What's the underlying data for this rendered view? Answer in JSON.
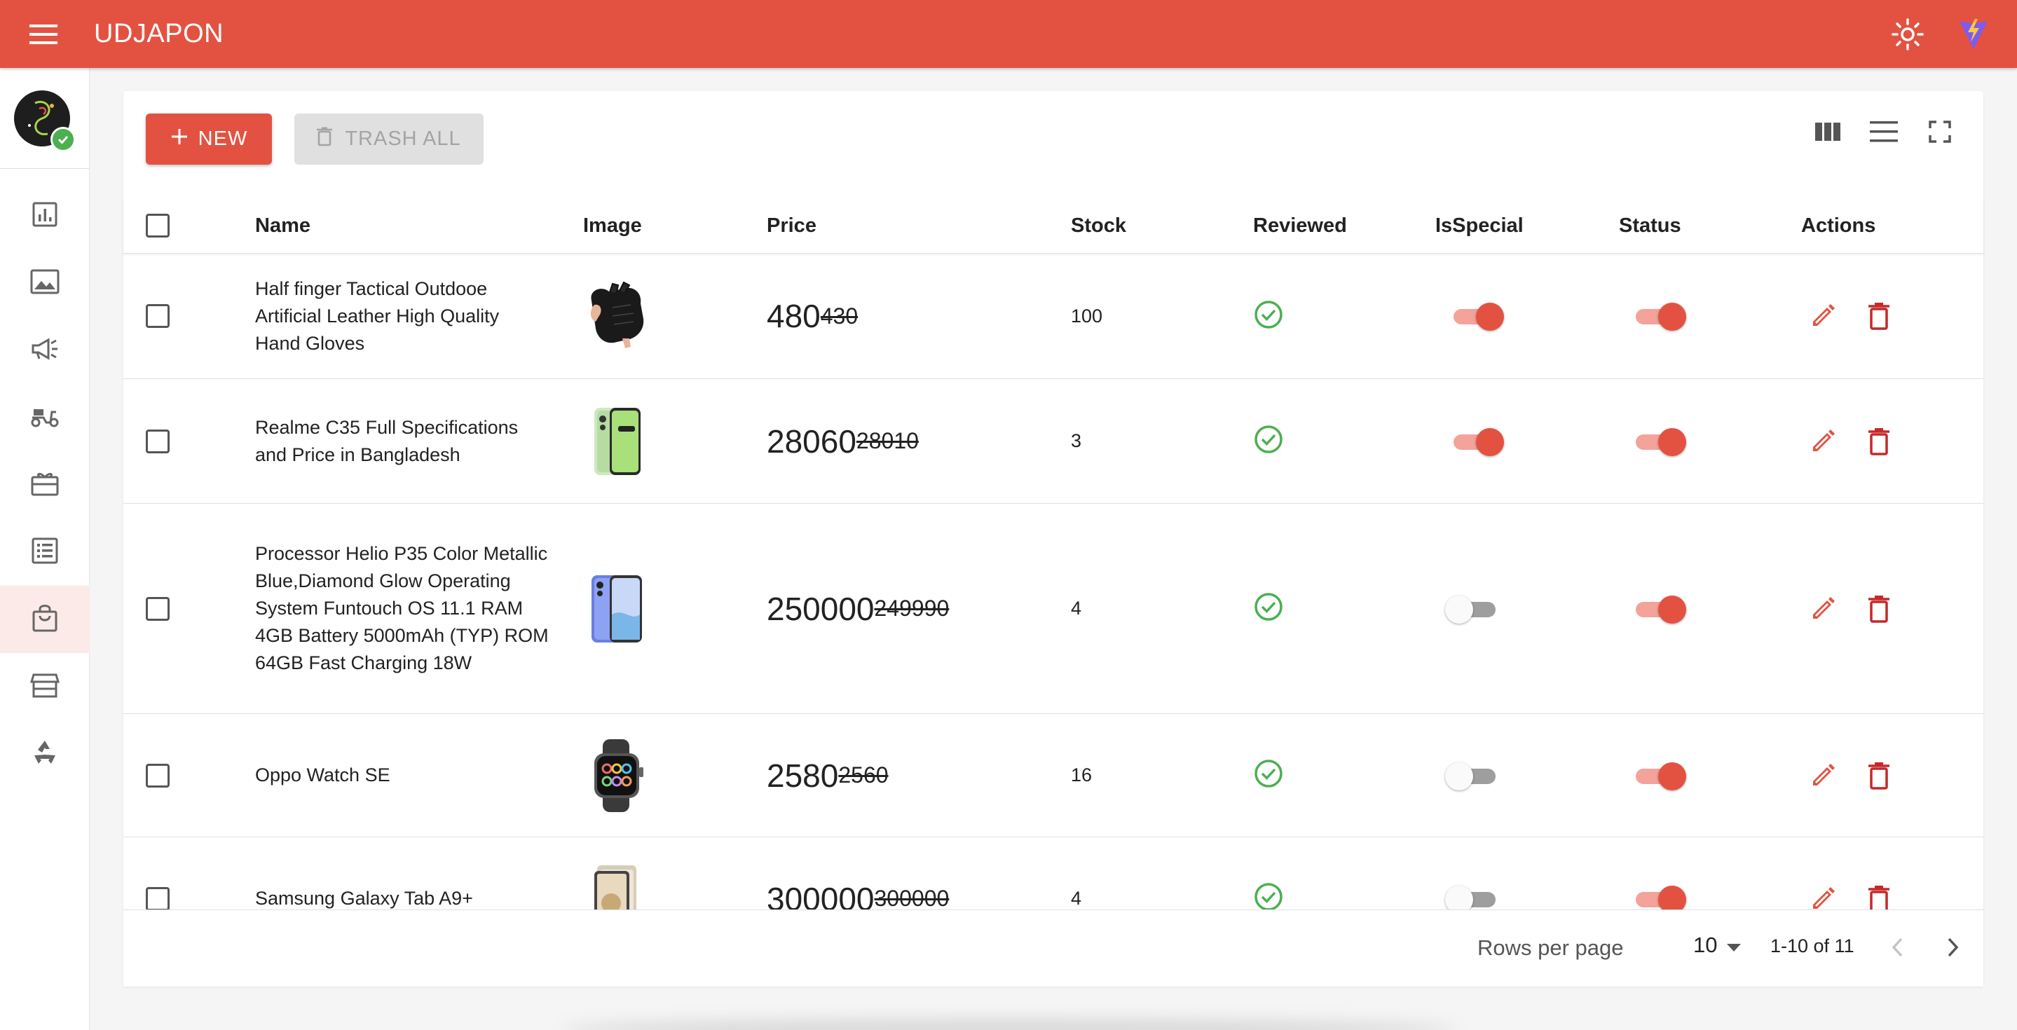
{
  "app": {
    "title": "UDJAPON"
  },
  "sidebar": {
    "items": [
      {
        "icon": "dashboard-chart-icon"
      },
      {
        "icon": "image-icon"
      },
      {
        "icon": "megaphone-icon"
      },
      {
        "icon": "delivery-scooter-icon"
      },
      {
        "icon": "gift-card-icon"
      },
      {
        "icon": "list-icon"
      },
      {
        "icon": "shopping-bag-icon",
        "active": true
      },
      {
        "icon": "store-icon"
      },
      {
        "icon": "recycle-icon"
      }
    ]
  },
  "toolbar": {
    "new_label": "NEW",
    "trash_all_label": "TRASH ALL"
  },
  "table": {
    "headers": [
      "Name",
      "Image",
      "Price",
      "Stock",
      "Reviewed",
      "IsSpecial",
      "Status",
      "Actions"
    ],
    "rows": [
      {
        "name": "Half finger Tactical Outdooe Artificial Leather High Quality Hand Gloves",
        "price": "480",
        "old_price": "430",
        "stock": "100",
        "reviewed": true,
        "is_special": true,
        "status": true,
        "image": "gloves"
      },
      {
        "name": "Realme C35 Full Specifications and Price in Bangladesh",
        "price": "28060",
        "old_price": "28010",
        "stock": "3",
        "reviewed": true,
        "is_special": true,
        "status": true,
        "image": "phone-green"
      },
      {
        "name": "Processor Helio P35 Color Metallic Blue,Diamond Glow Operating System Funtouch OS 11.1 RAM 4GB Battery 5000mAh (TYP) ROM 64GB Fast Charging 18W",
        "price": "250000",
        "old_price": "249990",
        "stock": "4",
        "reviewed": true,
        "is_special": false,
        "status": true,
        "image": "phone-blue"
      },
      {
        "name": "Oppo Watch SE",
        "price": "2580",
        "old_price": "2560",
        "stock": "16",
        "reviewed": true,
        "is_special": false,
        "status": true,
        "image": "watch"
      },
      {
        "name": "Samsung Galaxy Tab A9+",
        "price": "300000",
        "old_price": "300000",
        "stock": "4",
        "reviewed": true,
        "is_special": false,
        "status": true,
        "image": "tablet"
      }
    ]
  },
  "pagination": {
    "rows_per_page_label": "Rows per page",
    "rows_per_page": "10",
    "range": "1-10 of 11"
  },
  "colors": {
    "primary": "#e35241",
    "success": "#4caf50",
    "danger": "#c62828"
  }
}
